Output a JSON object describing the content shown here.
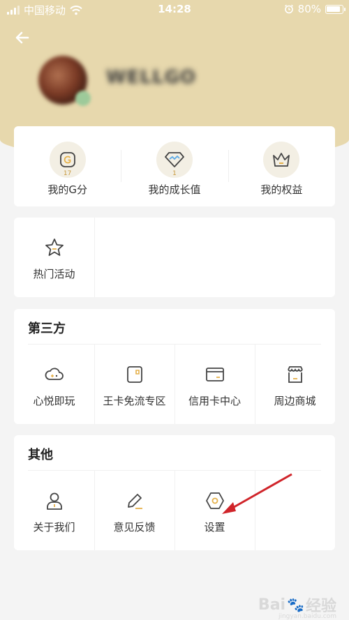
{
  "status_bar": {
    "carrier": "中国移动",
    "time": "14:28",
    "battery": "80%"
  },
  "profile": {
    "username": "WELLGO"
  },
  "top_items": [
    {
      "label": "我的G分",
      "badge": "17",
      "icon": "g-coin-icon"
    },
    {
      "label": "我的成长值",
      "badge": "1",
      "icon": "diamond-icon"
    },
    {
      "label": "我的权益",
      "icon": "crown-icon"
    }
  ],
  "hot": {
    "label": "热门活动",
    "icon": "star-icon"
  },
  "third_party": {
    "title": "第三方",
    "items": [
      {
        "label": "心悦即玩",
        "icon": "cloud-gamepad-icon"
      },
      {
        "label": "王卡免流专区",
        "icon": "sim-card-icon"
      },
      {
        "label": "信用卡中心",
        "icon": "credit-card-icon"
      },
      {
        "label": "周边商城",
        "icon": "shop-icon"
      }
    ]
  },
  "other": {
    "title": "其他",
    "items": [
      {
        "label": "关于我们",
        "icon": "user-icon"
      },
      {
        "label": "意见反馈",
        "icon": "pencil-icon"
      },
      {
        "label": "设置",
        "icon": "gear-hexagon-icon"
      }
    ]
  },
  "watermark": {
    "brand": "Bai",
    "brand_suffix": "经验",
    "sub": "jingyan.baidu.com"
  },
  "colors": {
    "header": "#e7d8ad",
    "accent": "#e5b14a",
    "icon_stroke": "#444444",
    "annotation_arrow": "#d0242a"
  }
}
